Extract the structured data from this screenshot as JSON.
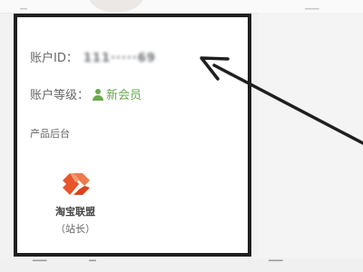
{
  "account": {
    "id_label": "账户ID：",
    "id_value": "111·····69",
    "level_label": "账户等级：",
    "level_icon": "member-user-icon",
    "level_value": "新会员",
    "level_color": "#6aa84f"
  },
  "products": {
    "section_title": "产品后台",
    "items": [
      {
        "icon": "alimama-logo-icon",
        "name": "淘宝联盟",
        "role": "（站长）",
        "color": "#e8542c"
      }
    ]
  },
  "annotation": {
    "border_color": "#1f1f1f",
    "arrow_color": "#1f1f1f"
  }
}
